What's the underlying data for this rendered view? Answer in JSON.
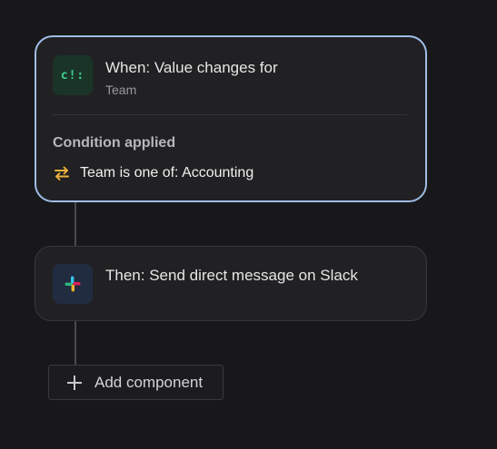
{
  "trigger": {
    "icon": "code-brackets-icon",
    "icon_glyph": "c!:",
    "title": "When: Value changes for",
    "subtitle": "Team",
    "condition_label": "Condition applied",
    "condition_icon": "swap-arrows-icon",
    "condition_text": "Team is one of: Accounting",
    "accent_color": "#9fbde6"
  },
  "action": {
    "icon": "slack-icon",
    "title": "Then: Send direct message on Slack"
  },
  "add_component": {
    "icon": "plus-icon",
    "label": "Add component"
  }
}
